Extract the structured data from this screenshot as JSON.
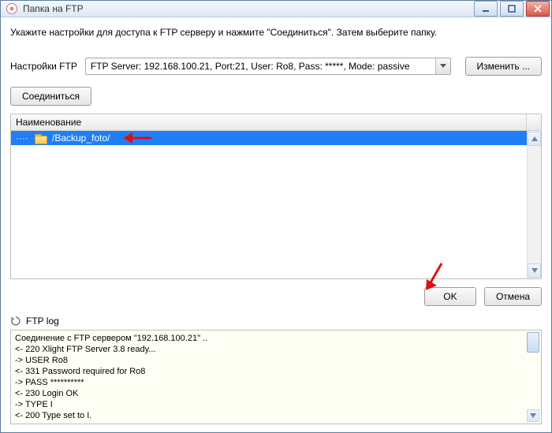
{
  "window": {
    "title": "Папка на FTP"
  },
  "instruction": "Укажите настройки для доступа к FTP серверу и нажмите \"Соединиться\". Затем выберите папку.",
  "settings": {
    "label": "Настройки FTP",
    "combo_value": "FTP Server: 192.168.100.21, Port:21, User: Ro8, Pass: *****, Mode: passive",
    "edit_btn": "Изменить ..."
  },
  "connect_btn": "Соединиться",
  "grid": {
    "header": "Наименование",
    "rows": [
      {
        "path": "/Backup_foto/"
      }
    ]
  },
  "buttons": {
    "ok": "OK",
    "cancel": "Отмена"
  },
  "log": {
    "title": "FTP log",
    "lines": [
      "Соединение с FTP сервером \"192.168.100.21\" ..",
      "<- 220 Xlight FTP Server 3.8 ready...",
      "-> USER Ro8",
      "<- 331 Password required for Ro8",
      "-> PASS **********",
      "<- 230 Login OK",
      "-> TYPE I",
      "<- 200 Type set to I."
    ]
  }
}
